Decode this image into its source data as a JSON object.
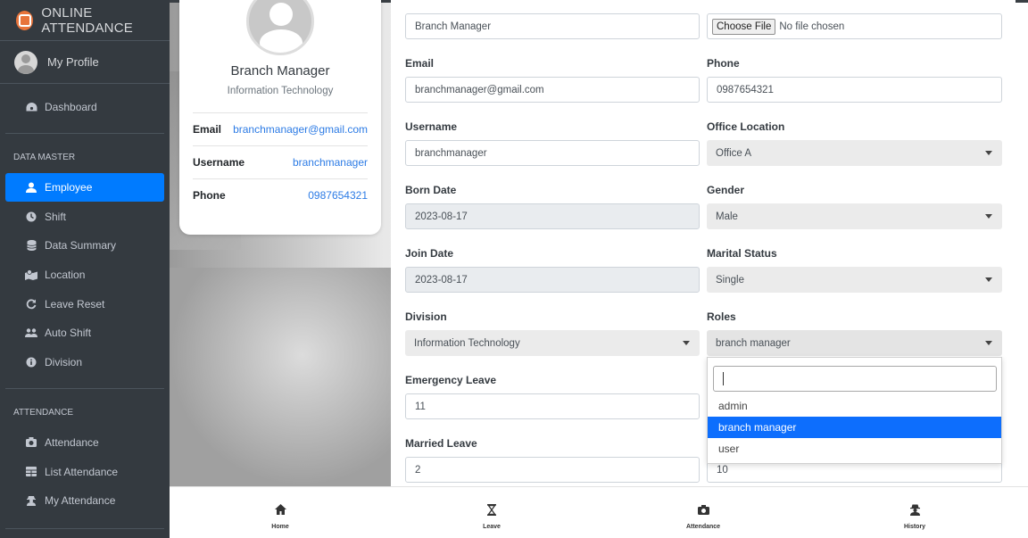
{
  "sidebar": {
    "brand": "ONLINE ATTENDANCE",
    "profile": "My Profile",
    "dashboard": "Dashboard",
    "data_master_header": "DATA MASTER",
    "data_master_items": [
      {
        "label": "Employee",
        "icon": "user-icon",
        "active": true
      },
      {
        "label": "Shift",
        "icon": "clock-icon"
      },
      {
        "label": "Data Summary",
        "icon": "database-icon"
      },
      {
        "label": "Location",
        "icon": "map-marker-icon"
      },
      {
        "label": "Leave Reset",
        "icon": "refresh-icon"
      },
      {
        "label": "Auto Shift",
        "icon": "users-cog-icon"
      },
      {
        "label": "Division",
        "icon": "info-circle-icon"
      }
    ],
    "attendance_header": "ATTENDANCE",
    "attendance_items": [
      {
        "label": "Attendance",
        "icon": "camera-icon"
      },
      {
        "label": "List Attendance",
        "icon": "table-icon"
      },
      {
        "label": "My Attendance",
        "icon": "user-secret-icon"
      }
    ]
  },
  "profile_card": {
    "name": "Branch Manager",
    "division": "Information Technology",
    "rows": [
      {
        "key": "Email",
        "value": "branchmanager@gmail.com"
      },
      {
        "key": "Username",
        "value": "branchmanager"
      },
      {
        "key": "Phone",
        "value": "0987654321"
      }
    ]
  },
  "form": {
    "full_name_value": "Branch Manager",
    "photo_button": "Choose File",
    "photo_status": "No file chosen",
    "email_label": "Email",
    "email_value": "branchmanager@gmail.com",
    "phone_label": "Phone",
    "phone_value": "0987654321",
    "username_label": "Username",
    "username_value": "branchmanager",
    "office_location_label": "Office Location",
    "office_location_value": "Office A",
    "born_date_label": "Born Date",
    "born_date_value": "2023-08-17",
    "gender_label": "Gender",
    "gender_value": "Male",
    "join_date_label": "Join Date",
    "join_date_value": "2023-08-17",
    "marital_status_label": "Marital Status",
    "marital_status_value": "Single",
    "division_label": "Division",
    "division_value": "Information Technology",
    "roles_label": "Roles",
    "roles_value": "branch manager",
    "emergency_leave_label": "Emergency Leave",
    "emergency_leave_value": "11",
    "married_leave_label": "Married Leave",
    "married_leave_value": "2",
    "right_bottom_value": "10"
  },
  "roles_dropdown": {
    "search_value": "",
    "options": [
      "admin",
      "branch manager",
      "user"
    ],
    "selected": "branch manager"
  },
  "bottom_nav": [
    {
      "label": "Home",
      "icon": "home-icon"
    },
    {
      "label": "Leave",
      "icon": "hourglass-icon"
    },
    {
      "label": "Attendance",
      "icon": "camera-icon"
    },
    {
      "label": "History",
      "icon": "user-secret-icon"
    }
  ],
  "colors": {
    "sidebar_bg": "#343a40",
    "active_blue": "#007bff",
    "link_blue": "#2c7be5",
    "option_selected": "#0d6efd"
  }
}
